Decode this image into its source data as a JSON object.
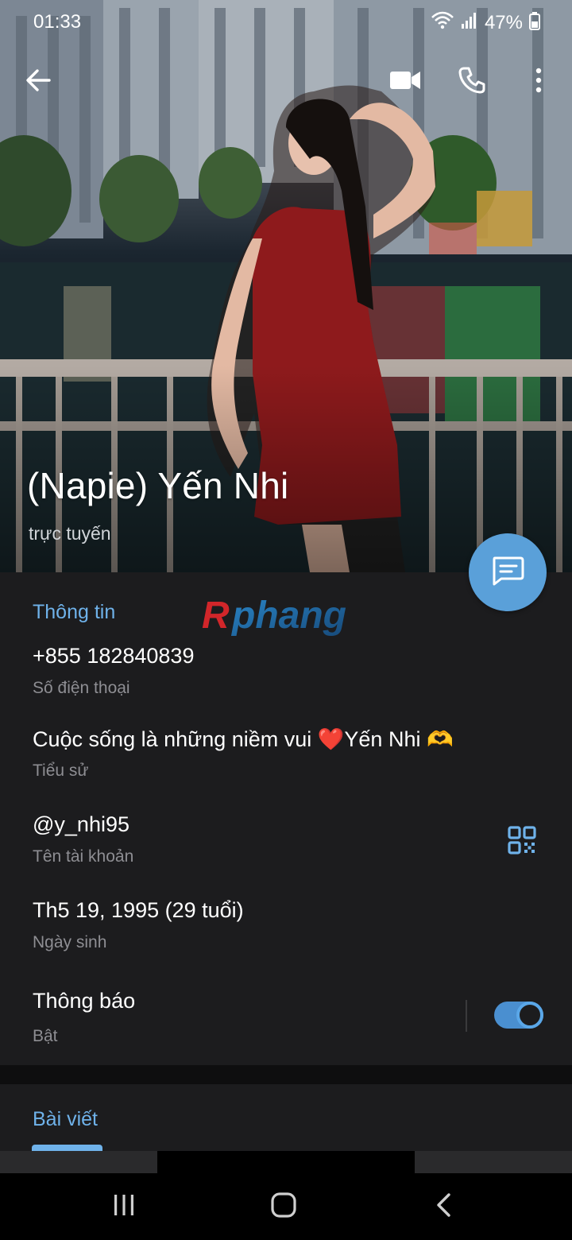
{
  "status_bar": {
    "time": "01:33",
    "battery": "47%"
  },
  "icons": {
    "back": "arrow-left-icon",
    "video": "video-camera-icon",
    "call": "phone-icon",
    "more": "more-vertical-icon",
    "message": "chat-bubble-icon",
    "qr": "qr-code-icon"
  },
  "profile": {
    "name": "(Napie) Yến Nhi",
    "status": "trực tuyến"
  },
  "watermark": "Rphang",
  "info": {
    "section_title": "Thông tin",
    "phone": {
      "value": "+855 182840839",
      "label": "Số điện thoại"
    },
    "bio": {
      "value": "Cuộc sống là những niềm vui ❤️Yến Nhi 🫶",
      "label": "Tiểu sử"
    },
    "username": {
      "value": "@y_nhi95",
      "label": "Tên tài khoản"
    },
    "birthday": {
      "value": "Th5 19, 1995 (29 tuổi)",
      "label": "Ngày sinh"
    },
    "notifications": {
      "value": "Thông báo",
      "label": "Bật",
      "enabled": true
    }
  },
  "posts": {
    "tab_label": "Bài viết"
  },
  "colors": {
    "accent": "#6fb2ea",
    "fab": "#5aa0d9",
    "card": "#1c1c1e",
    "secondary_text": "#8e8e93"
  }
}
